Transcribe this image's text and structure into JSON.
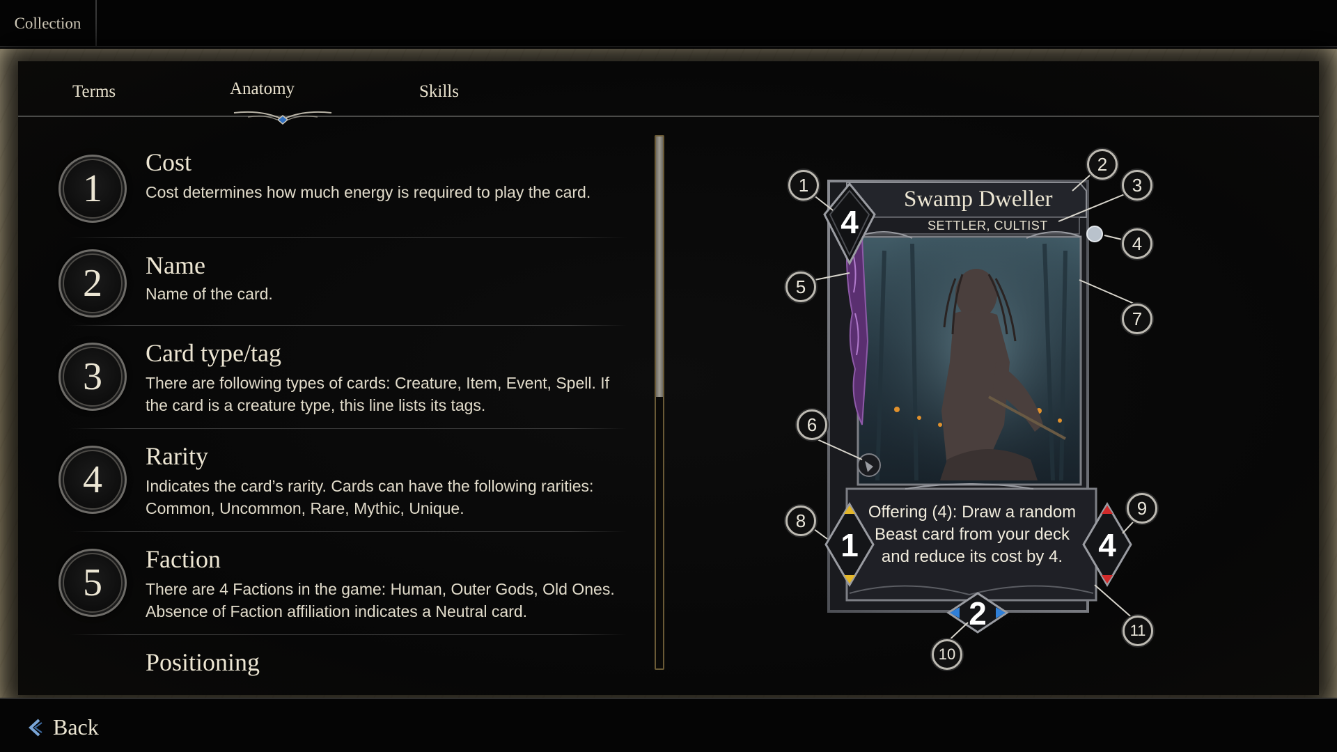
{
  "topbar": {
    "tab_label": "Collection"
  },
  "tabs": [
    {
      "label": "Terms",
      "active": false
    },
    {
      "label": "Anatomy",
      "active": true
    },
    {
      "label": "Skills",
      "active": false
    }
  ],
  "entries": [
    {
      "number": "1",
      "title": "Cost",
      "description": "Cost determines how much energy is required to play the card."
    },
    {
      "number": "2",
      "title": "Name",
      "description": "Name of the card."
    },
    {
      "number": "3",
      "title": "Card type/tag",
      "description": "There are following types of cards: Creature, Item, Event, Spell. If the card is a creature type, this line lists its tags."
    },
    {
      "number": "4",
      "title": "Rarity",
      "description": "Indicates the card’s rarity. Cards can have the following rarities: Common, Uncommon, Rare, Mythic, Unique."
    },
    {
      "number": "5",
      "title": "Faction",
      "description": "There are 4 Factions in the game: Human, Outer Gods, Old Ones. Absence of Faction affiliation indicates a Neutral card."
    },
    {
      "number": "",
      "title": "Positioning",
      "description": ""
    }
  ],
  "card": {
    "name": "Swamp Dweller",
    "tags": "SETTLER, CULTIST",
    "cost": "4",
    "attack": "1",
    "health": "4",
    "bottom_value": "2",
    "text": "Offering (4): Draw a random Beast card from your deck and reduce its cost by 4.",
    "colors": {
      "frame": "#5f6168",
      "cost_gem": "#141414",
      "attack_arrow": "#e3b62a",
      "health_arrow": "#d12a2a",
      "bottom_arrow": "#2f7fd8"
    }
  },
  "callouts": [
    "1",
    "2",
    "3",
    "4",
    "5",
    "6",
    "7",
    "8",
    "9",
    "10",
    "11"
  ],
  "bottombar": {
    "back_label": "Back"
  }
}
